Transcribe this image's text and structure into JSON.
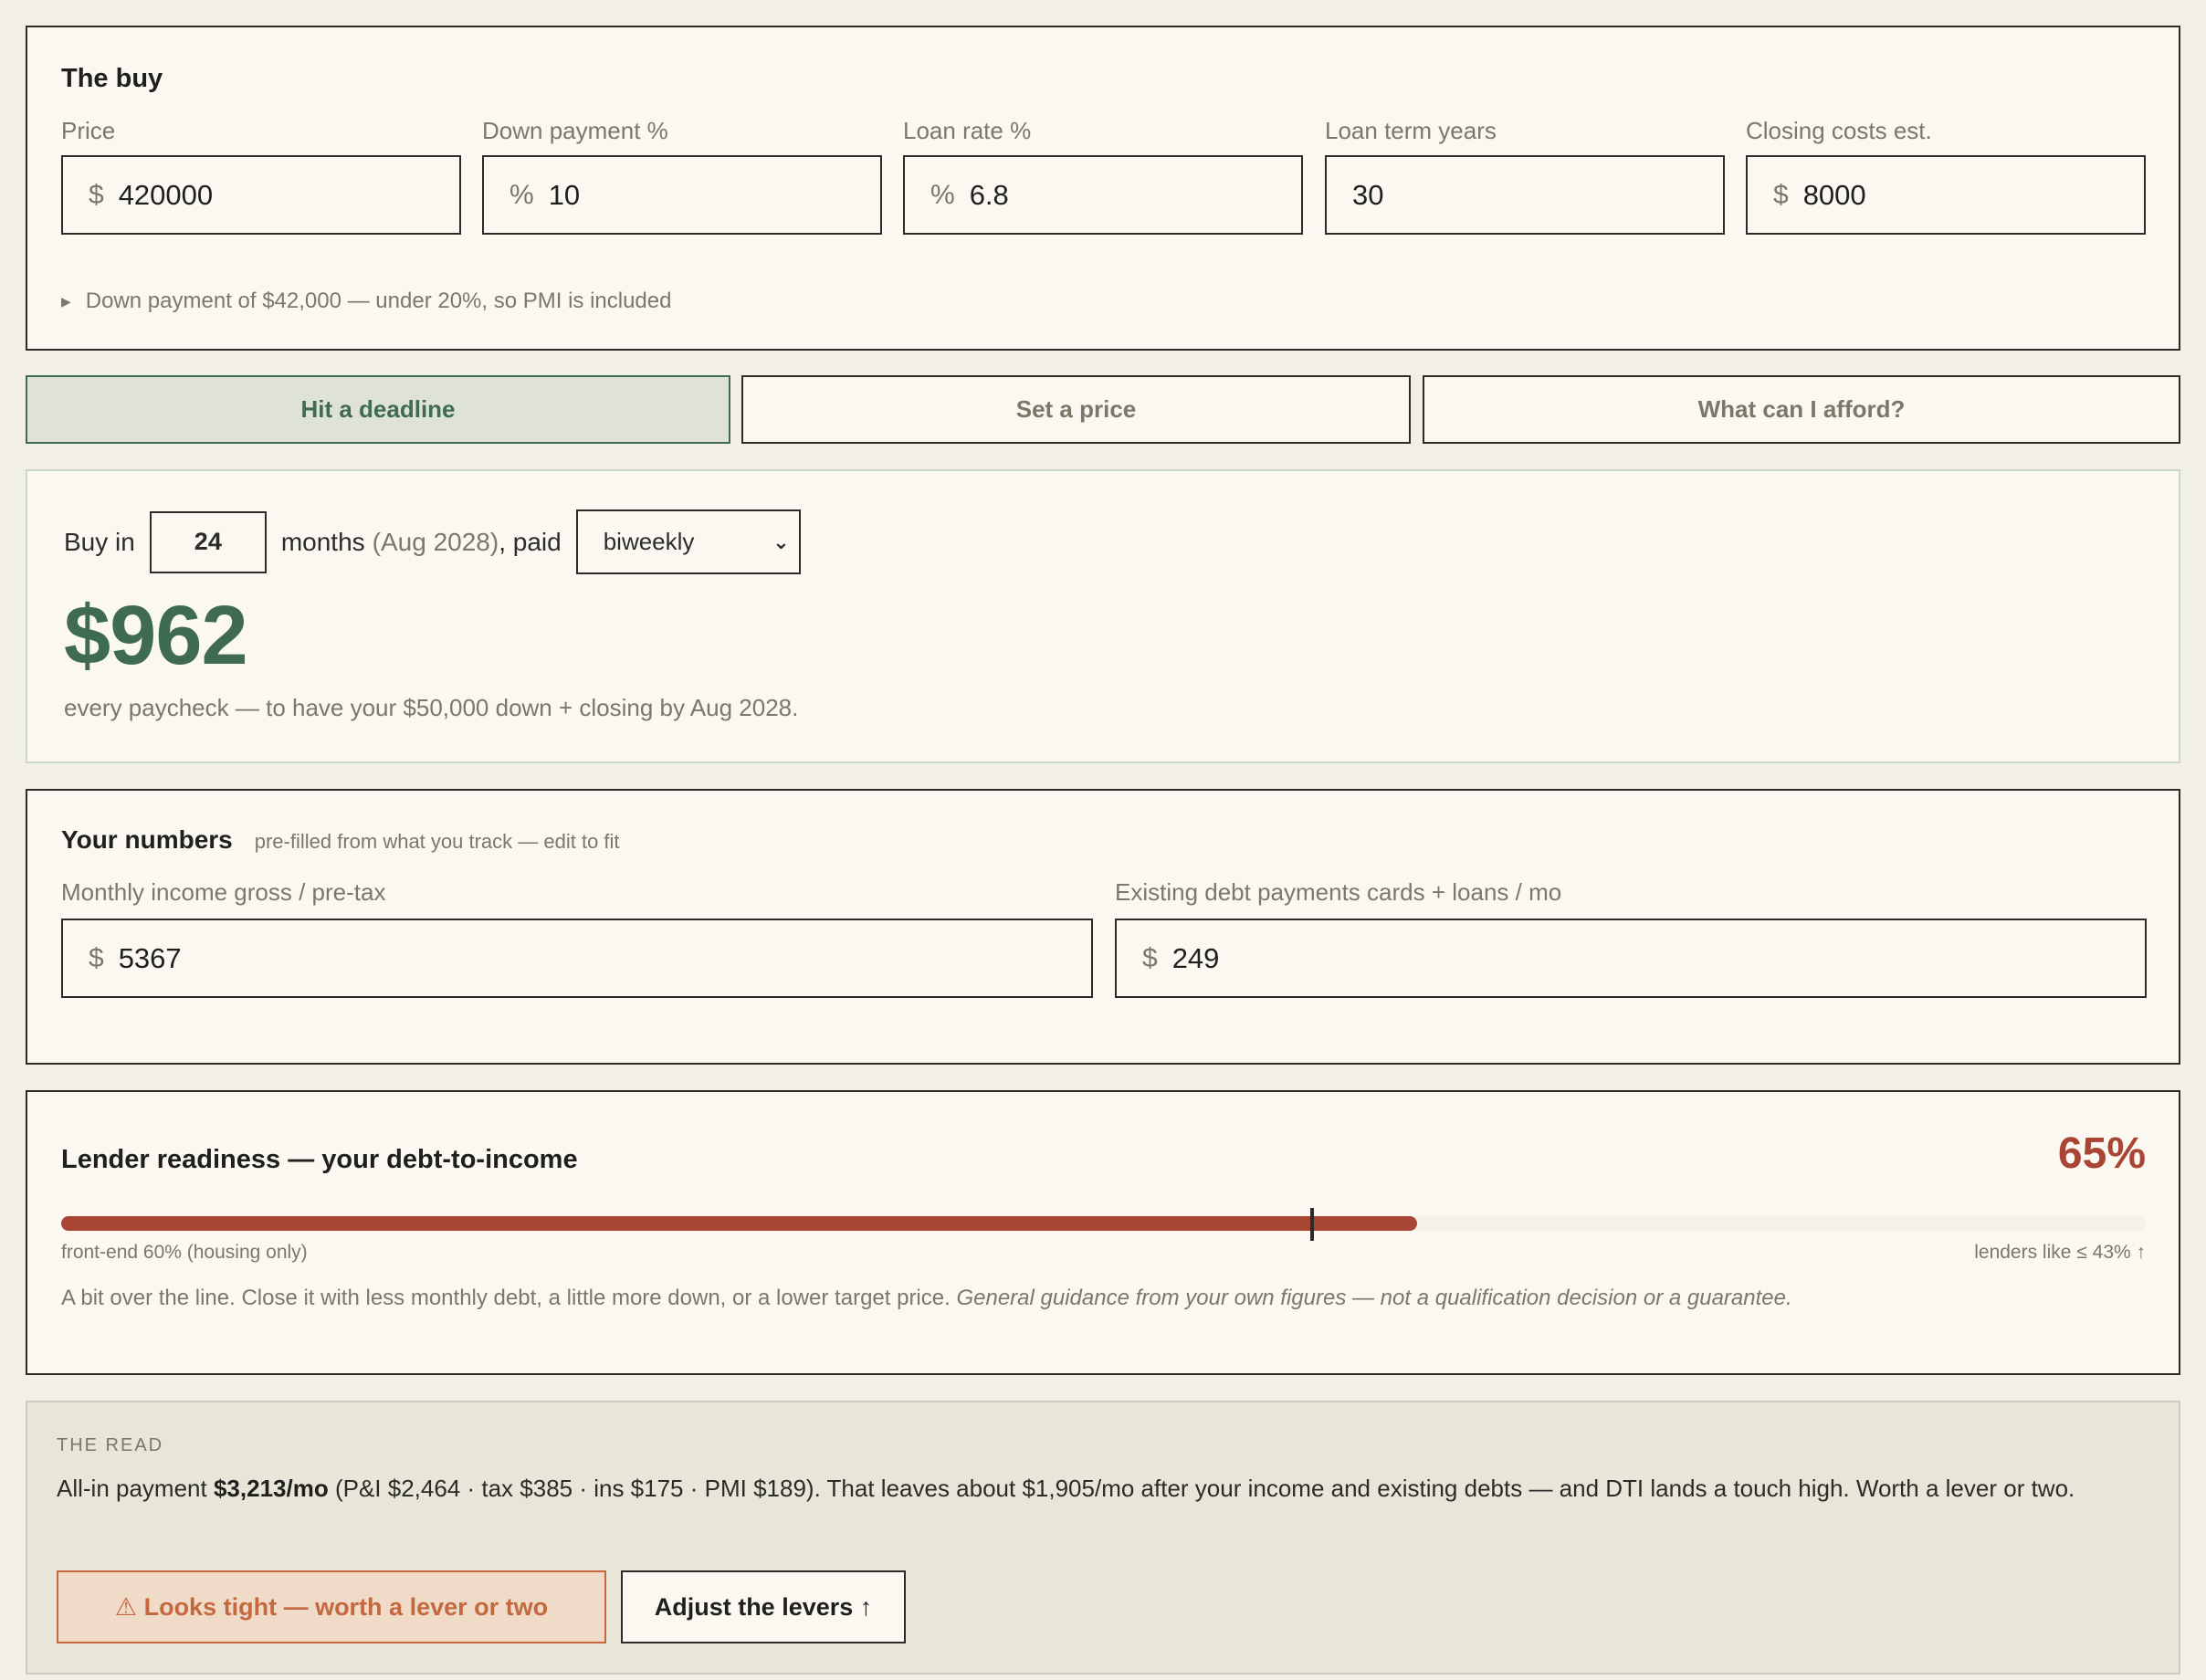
{
  "buy": {
    "title": "The buy",
    "fields": [
      {
        "label": "Price",
        "prefix": "$",
        "value": "420000"
      },
      {
        "label": "Down payment %",
        "prefix": "%",
        "value": "10"
      },
      {
        "label": "Loan rate %",
        "prefix": "%",
        "value": "6.8"
      },
      {
        "label": "Loan term years",
        "prefix": "",
        "value": "30"
      },
      {
        "label": "Closing costs est.",
        "prefix": "$",
        "value": "8000"
      }
    ],
    "note": "Down payment of $42,000 — under 20%, so PMI is included"
  },
  "tabs": [
    {
      "label": "Hit a deadline",
      "active": true
    },
    {
      "label": "Set a price",
      "active": false
    },
    {
      "label": "What can I afford?",
      "active": false
    }
  ],
  "deadline": {
    "prefix": "Buy in",
    "months": "24",
    "months_label": "months",
    "date_paren": "(Aug 2028)",
    "paid_label": ", paid",
    "frequency": "biweekly",
    "amount": "$962",
    "subtext": "every paycheck — to have your $50,000 down + closing by Aug 2028."
  },
  "numbers": {
    "title": "Your numbers",
    "subtitle": "pre-filled from what you track — edit to fit",
    "income_label": "Monthly income gross / pre-tax",
    "income_prefix": "$",
    "income_value": "5367",
    "debt_label": "Existing debt payments cards + loans / mo",
    "debt_prefix": "$",
    "debt_value": "249"
  },
  "lender": {
    "title": "Lender readiness — your debt-to-income",
    "percent_text": "65%",
    "dti_value": 65,
    "front_end_value": 60,
    "bar_max": 100,
    "left_caption": "front-end 60% (housing only)",
    "right_caption": "lenders like ≤ 43% ↑",
    "note": "A bit over the line. Close it with less monthly debt, a little more down, or a lower target price.",
    "note_italic": "General guidance from your own figures — not a qualification decision or a guarantee.",
    "bar_color": "#a94535"
  },
  "read": {
    "kicker": "THE READ",
    "text_lead": "All-in payment ",
    "text_bold": "$3,213/mo",
    "text_rest": " (P&I $2,464 · tax $385 · ins $175 · PMI $189). That leaves about $1,905/mo after your income and existing debts — and DTI lands a touch high. Worth a lever or two.",
    "warning_label": "⚠ Looks tight — worth a lever or two",
    "adjust_label": "Adjust the levers ↑"
  },
  "colors": {
    "accent_green": "#3f6b55",
    "alert_red": "#a94535",
    "warning_orange": "#c4683f",
    "background": "#f2efe6"
  }
}
